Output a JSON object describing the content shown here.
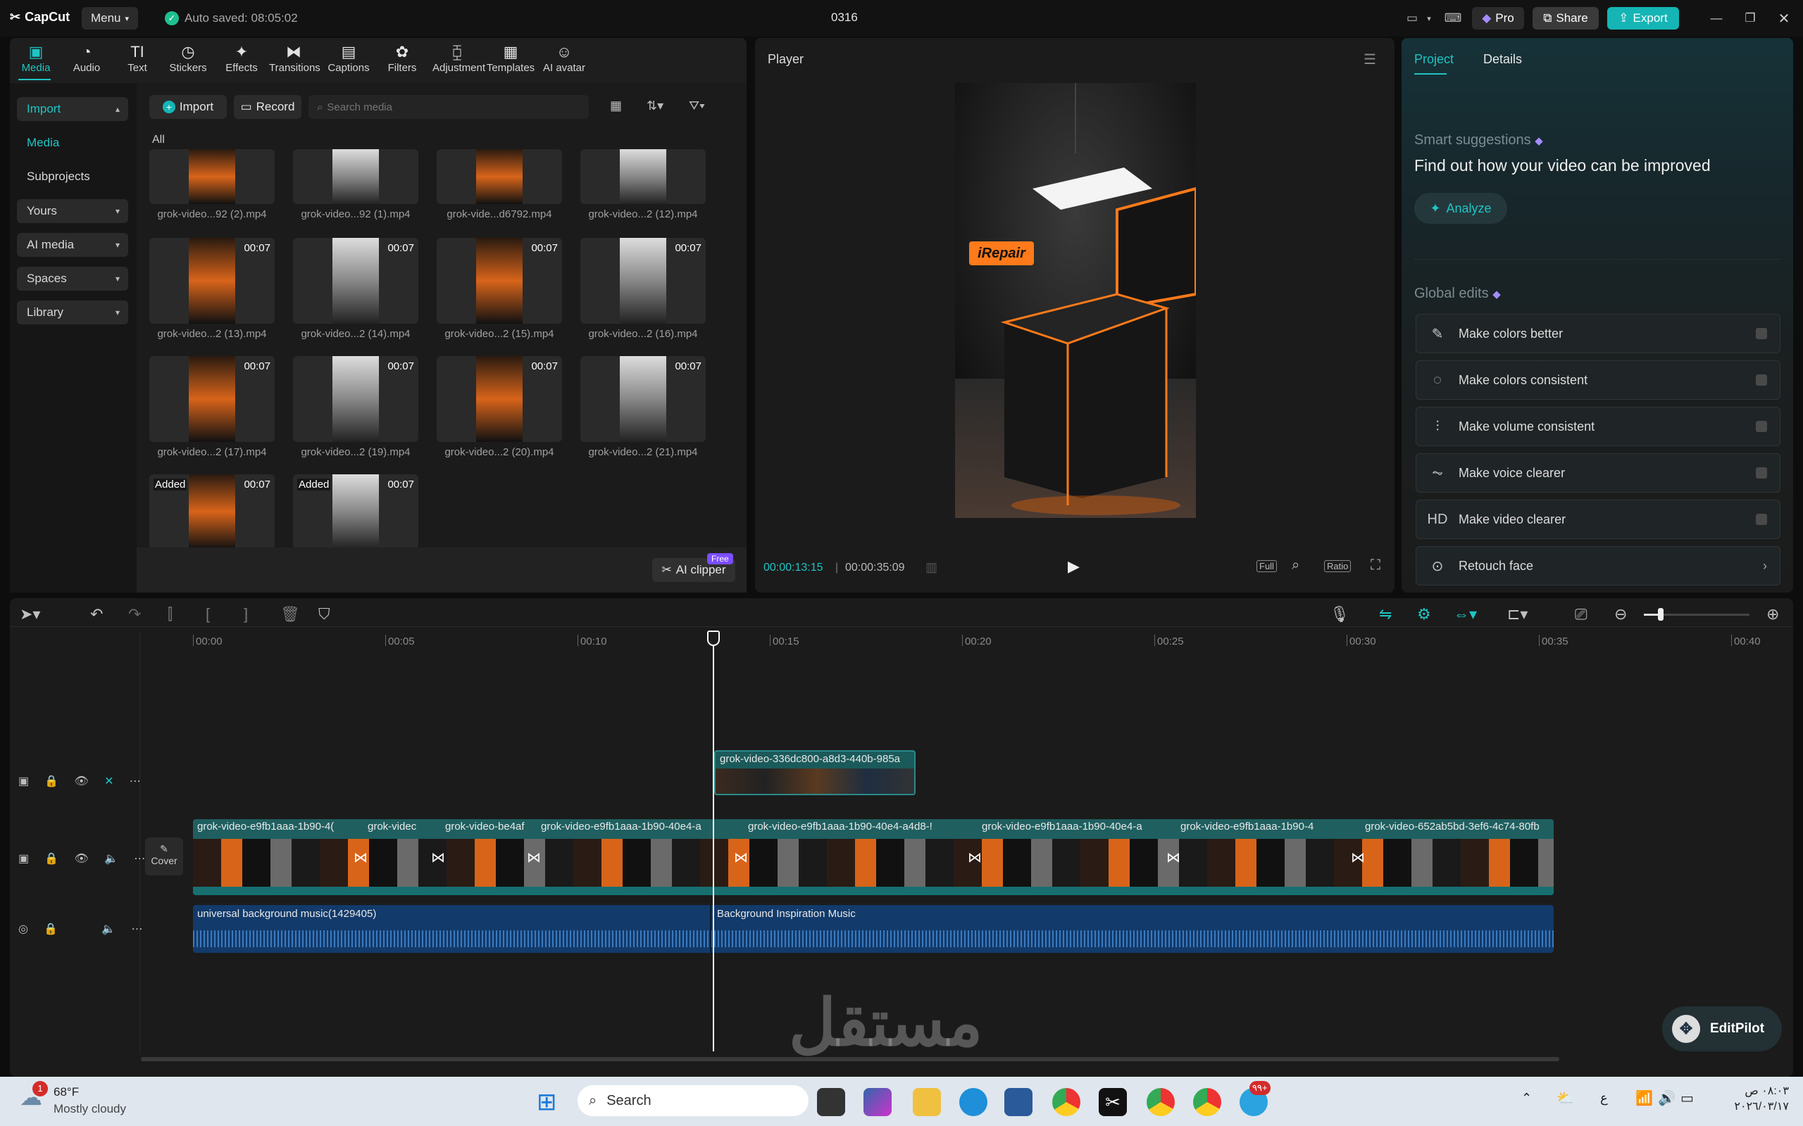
{
  "app": {
    "name": "CapCut",
    "menu_label": "Menu",
    "autosave": "Auto saved: 08:05:02",
    "project_title": "0316",
    "pro_label": "Pro",
    "share_label": "Share",
    "export_label": "Export"
  },
  "toolbar": {
    "tools": [
      {
        "label": "Media",
        "icon": "media-icon"
      },
      {
        "label": "Audio",
        "icon": "audio-icon"
      },
      {
        "label": "Text",
        "icon": "text-icon"
      },
      {
        "label": "Stickers",
        "icon": "stickers-icon"
      },
      {
        "label": "Effects",
        "icon": "effects-icon"
      },
      {
        "label": "Transitions",
        "icon": "transitions-icon"
      },
      {
        "label": "Captions",
        "icon": "captions-icon"
      },
      {
        "label": "Filters",
        "icon": "filters-icon"
      },
      {
        "label": "Adjustment",
        "icon": "adjustment-icon"
      },
      {
        "label": "Templates",
        "icon": "templates-icon"
      },
      {
        "label": "AI avatar",
        "icon": "ai-avatar-icon"
      }
    ]
  },
  "sidebar": {
    "items": [
      "Import",
      "Media",
      "Subprojects",
      "Yours",
      "AI media",
      "Spaces",
      "Library"
    ]
  },
  "media": {
    "import_label": "Import",
    "record_label": "Record",
    "search_placeholder": "Search media",
    "filter_label": "All",
    "ai_clipper_label": "AI clipper",
    "free_badge": "Free",
    "items": [
      {
        "name": "grok-video...92 (2).mp4",
        "duration": "",
        "added": ""
      },
      {
        "name": "grok-video...92 (1).mp4",
        "duration": "",
        "added": ""
      },
      {
        "name": "grok-vide...d6792.mp4",
        "duration": "",
        "added": ""
      },
      {
        "name": "grok-video...2 (12).mp4",
        "duration": "",
        "added": ""
      },
      {
        "name": "grok-video...2 (13).mp4",
        "duration": "00:07",
        "added": ""
      },
      {
        "name": "grok-video...2 (14).mp4",
        "duration": "00:07",
        "added": ""
      },
      {
        "name": "grok-video...2 (15).mp4",
        "duration": "00:07",
        "added": ""
      },
      {
        "name": "grok-video...2 (16).mp4",
        "duration": "00:07",
        "added": ""
      },
      {
        "name": "grok-video...2 (17).mp4",
        "duration": "00:07",
        "added": ""
      },
      {
        "name": "grok-video...2 (19).mp4",
        "duration": "00:07",
        "added": ""
      },
      {
        "name": "grok-video...2 (20).mp4",
        "duration": "00:07",
        "added": ""
      },
      {
        "name": "grok-video...2 (21).mp4",
        "duration": "00:07",
        "added": ""
      },
      {
        "name": "",
        "duration": "00:07",
        "added": "Added"
      },
      {
        "name": "",
        "duration": "00:07",
        "added": "Added"
      }
    ]
  },
  "player": {
    "title": "Player",
    "current_time": "00:00:13:15",
    "total_time": "00:00:35:09",
    "full_label": "Full",
    "ratio_label": "Ratio",
    "preview_text": "iRepair"
  },
  "right_panel": {
    "tab_project": "Project",
    "tab_details": "Details",
    "smart_title": "Smart suggestions",
    "smart_desc": "Find out how your video can be improved",
    "analyze_label": "Analyze",
    "global_title": "Global edits",
    "edits": [
      {
        "label": "Make colors better",
        "icon": "wand-icon"
      },
      {
        "label": "Make colors consistent",
        "icon": "palette-icon"
      },
      {
        "label": "Make volume consistent",
        "icon": "sliders-icon"
      },
      {
        "label": "Make voice clearer",
        "icon": "waveform-icon"
      },
      {
        "label": "Make video clearer",
        "icon": "hd-icon"
      },
      {
        "label": "Retouch face",
        "icon": "face-icon"
      }
    ]
  },
  "timeline": {
    "ruler": [
      "00:00",
      "00:05",
      "00:10",
      "00:15",
      "00:20",
      "00:25",
      "00:30",
      "00:35",
      "00:40"
    ],
    "cover_label": "Cover",
    "overlay_clip": "grok-video-336dc800-a8d3-440b-985a",
    "main_clips": [
      "grok-video-e9fb1aaa-1b90-4(",
      "grok-videc",
      "grok-video-be4af",
      "grok-video-e9fb1aaa-1b90-40e4-a",
      "grok-video-e9fb1aaa-1b90-40e4-a4d8-!",
      "grok-video-e9fb1aaa-1b90-40e4-a",
      "grok-video-e9fb1aaa-1b90-4",
      "grok-video-652ab5bd-3ef6-4c74-80fb"
    ],
    "audio_clips": [
      "universal background music(1429405)",
      "Background Inspiration Music"
    ],
    "editpilot_label": "EditPilot"
  },
  "taskbar": {
    "weather_temp": "68°F",
    "weather_desc": "Mostly cloudy",
    "weather_badge": "1",
    "search_label": "Search",
    "clock_time": "٠٨:٠٣ ص",
    "clock_date": "٢٠٢٦/٠٣/١٧",
    "lang": "ع",
    "badge_99": "٩٩+"
  },
  "watermark": "مستقل"
}
